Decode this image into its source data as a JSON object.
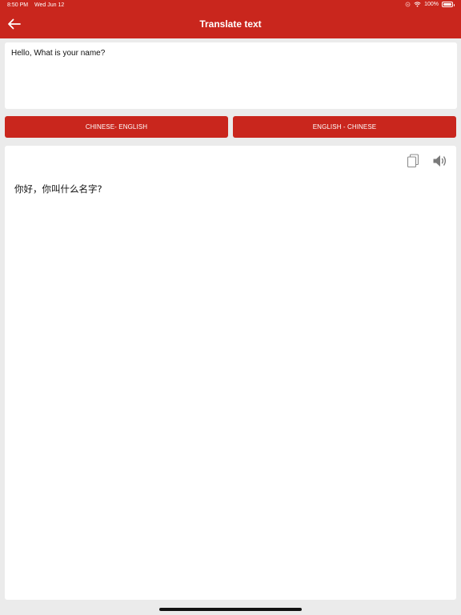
{
  "status": {
    "time": "8:50 PM",
    "date": "Wed Jun 12",
    "battery": "100%",
    "battery_level": 1.0,
    "icons": [
      "orientation-lock-icon",
      "wifi-icon",
      "battery-icon"
    ]
  },
  "header": {
    "title": "Translate text",
    "back_icon": "arrow-left-icon",
    "color": "#c9261d"
  },
  "input": {
    "value": "Hello, What is your name?"
  },
  "buttons": {
    "chinese_english": "CHINESE- ENGLISH",
    "english_chinese": "ENGLISH - CHINESE"
  },
  "output": {
    "text": "你好，你叫什么名字?",
    "copy_icon": "copy-icon",
    "speaker_icon": "speaker-icon"
  }
}
